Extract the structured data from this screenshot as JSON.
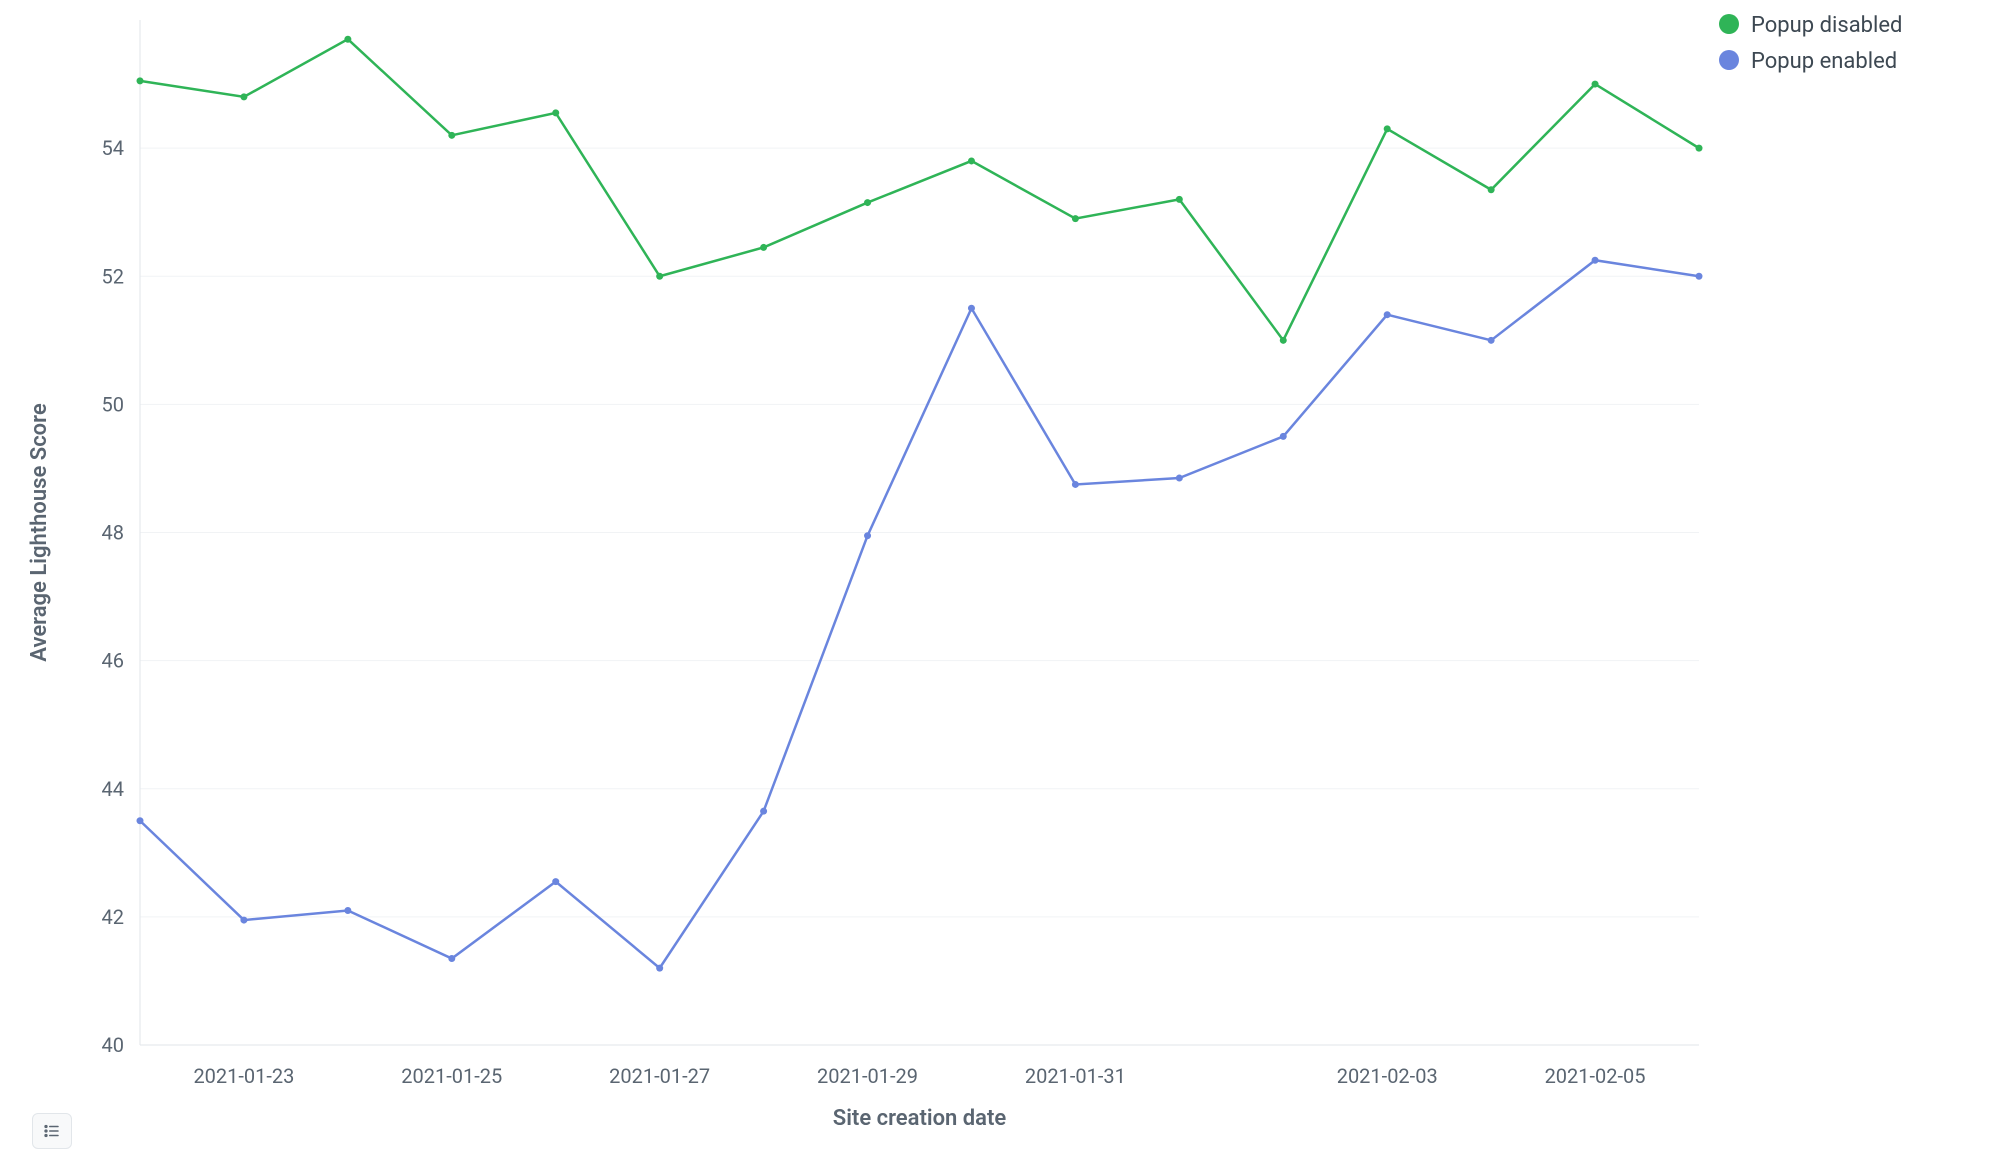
{
  "chart_data": {
    "type": "line",
    "xlabel": "Site creation date",
    "ylabel": "Average Lighthouse Score",
    "ylim": [
      40,
      56
    ],
    "yticks": [
      40,
      42,
      44,
      46,
      48,
      50,
      52,
      54
    ],
    "categories": [
      "2021-01-22",
      "2021-01-23",
      "2021-01-24",
      "2021-01-25",
      "2021-01-26",
      "2021-01-27",
      "2021-01-28",
      "2021-01-29",
      "2021-01-30",
      "2021-01-31",
      "2021-02-01",
      "2021-02-02",
      "2021-02-03",
      "2021-02-04",
      "2021-02-05",
      "2021-02-06"
    ],
    "xticks": [
      "2021-01-23",
      "2021-01-25",
      "2021-01-27",
      "2021-01-29",
      "2021-01-31",
      "2021-02-03",
      "2021-02-05"
    ],
    "series": [
      {
        "name": "Popup disabled",
        "color": "#2fb457",
        "values": [
          55.05,
          54.8,
          55.7,
          54.2,
          54.55,
          52.0,
          52.45,
          53.15,
          53.8,
          52.9,
          53.2,
          51.0,
          54.3,
          53.35,
          55.0,
          54.0
        ]
      },
      {
        "name": "Popup enabled",
        "color": "#6a85de",
        "values": [
          43.5,
          41.95,
          42.1,
          41.35,
          42.55,
          41.2,
          43.65,
          47.95,
          51.5,
          48.75,
          48.85,
          49.5,
          51.4,
          51.0,
          52.25,
          52.0
        ]
      }
    ],
    "legend_position": "top-right"
  },
  "ui": {
    "legend_button_title": "Toggle legend"
  }
}
